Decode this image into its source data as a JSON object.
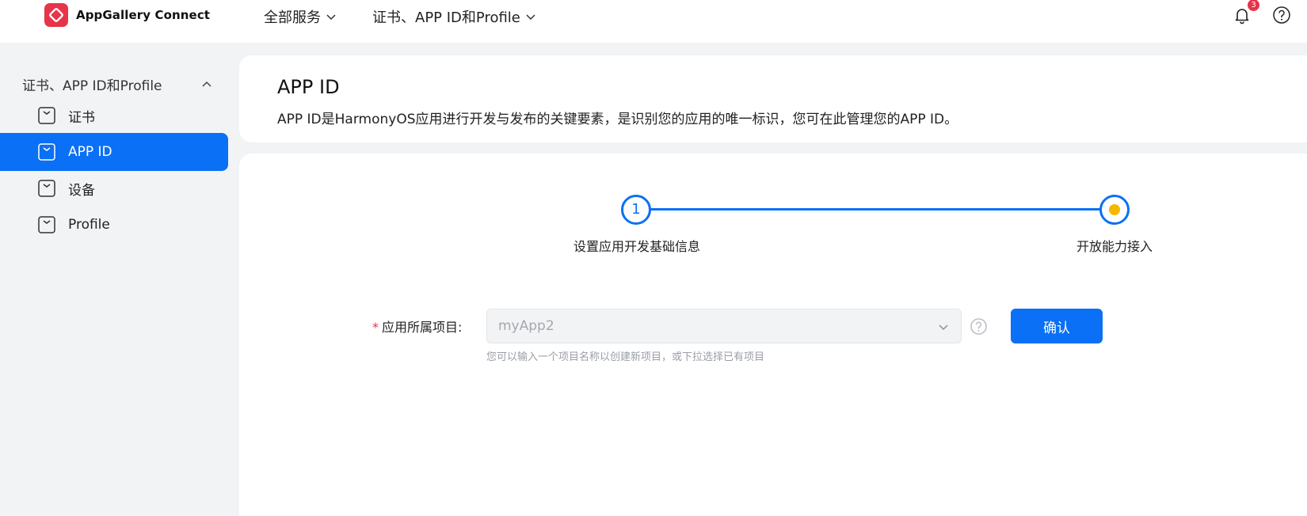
{
  "header": {
    "brand": "AppGallery Connect",
    "nav": [
      {
        "label": "全部服务"
      },
      {
        "label": "证书、APP ID和Profile"
      }
    ],
    "notification_count": "3",
    "icons": {
      "logo": "appgallery-logo-icon",
      "bell": "bell-icon",
      "help": "help-icon"
    }
  },
  "sidebar": {
    "group_label": "证书、APP ID和Profile",
    "items": [
      {
        "label": "证书",
        "active": false
      },
      {
        "label": "APP ID",
        "active": true
      },
      {
        "label": "设备",
        "active": false
      },
      {
        "label": "Profile",
        "active": false
      }
    ]
  },
  "page": {
    "title": "APP ID",
    "description": "APP ID是HarmonyOS应用进行开发与发布的关键要素，是识别您的应用的唯一标识，您可在此管理您的APP ID。"
  },
  "stepper": {
    "steps": [
      {
        "number": "1",
        "label": "设置应用开发基础信息"
      },
      {
        "label": "开放能力接入"
      }
    ]
  },
  "form": {
    "required_mark": "*",
    "project_label": "应用所属项目:",
    "project_value": "myApp2",
    "hint": "您可以输入一个项目名称以创建新项目，或下拉选择已有项目",
    "confirm_label": "确认"
  },
  "colors": {
    "accent": "#0a70f5",
    "brand_red": "#e8334a",
    "step_dot": "#f5b800",
    "background": "#f1f3f5"
  }
}
